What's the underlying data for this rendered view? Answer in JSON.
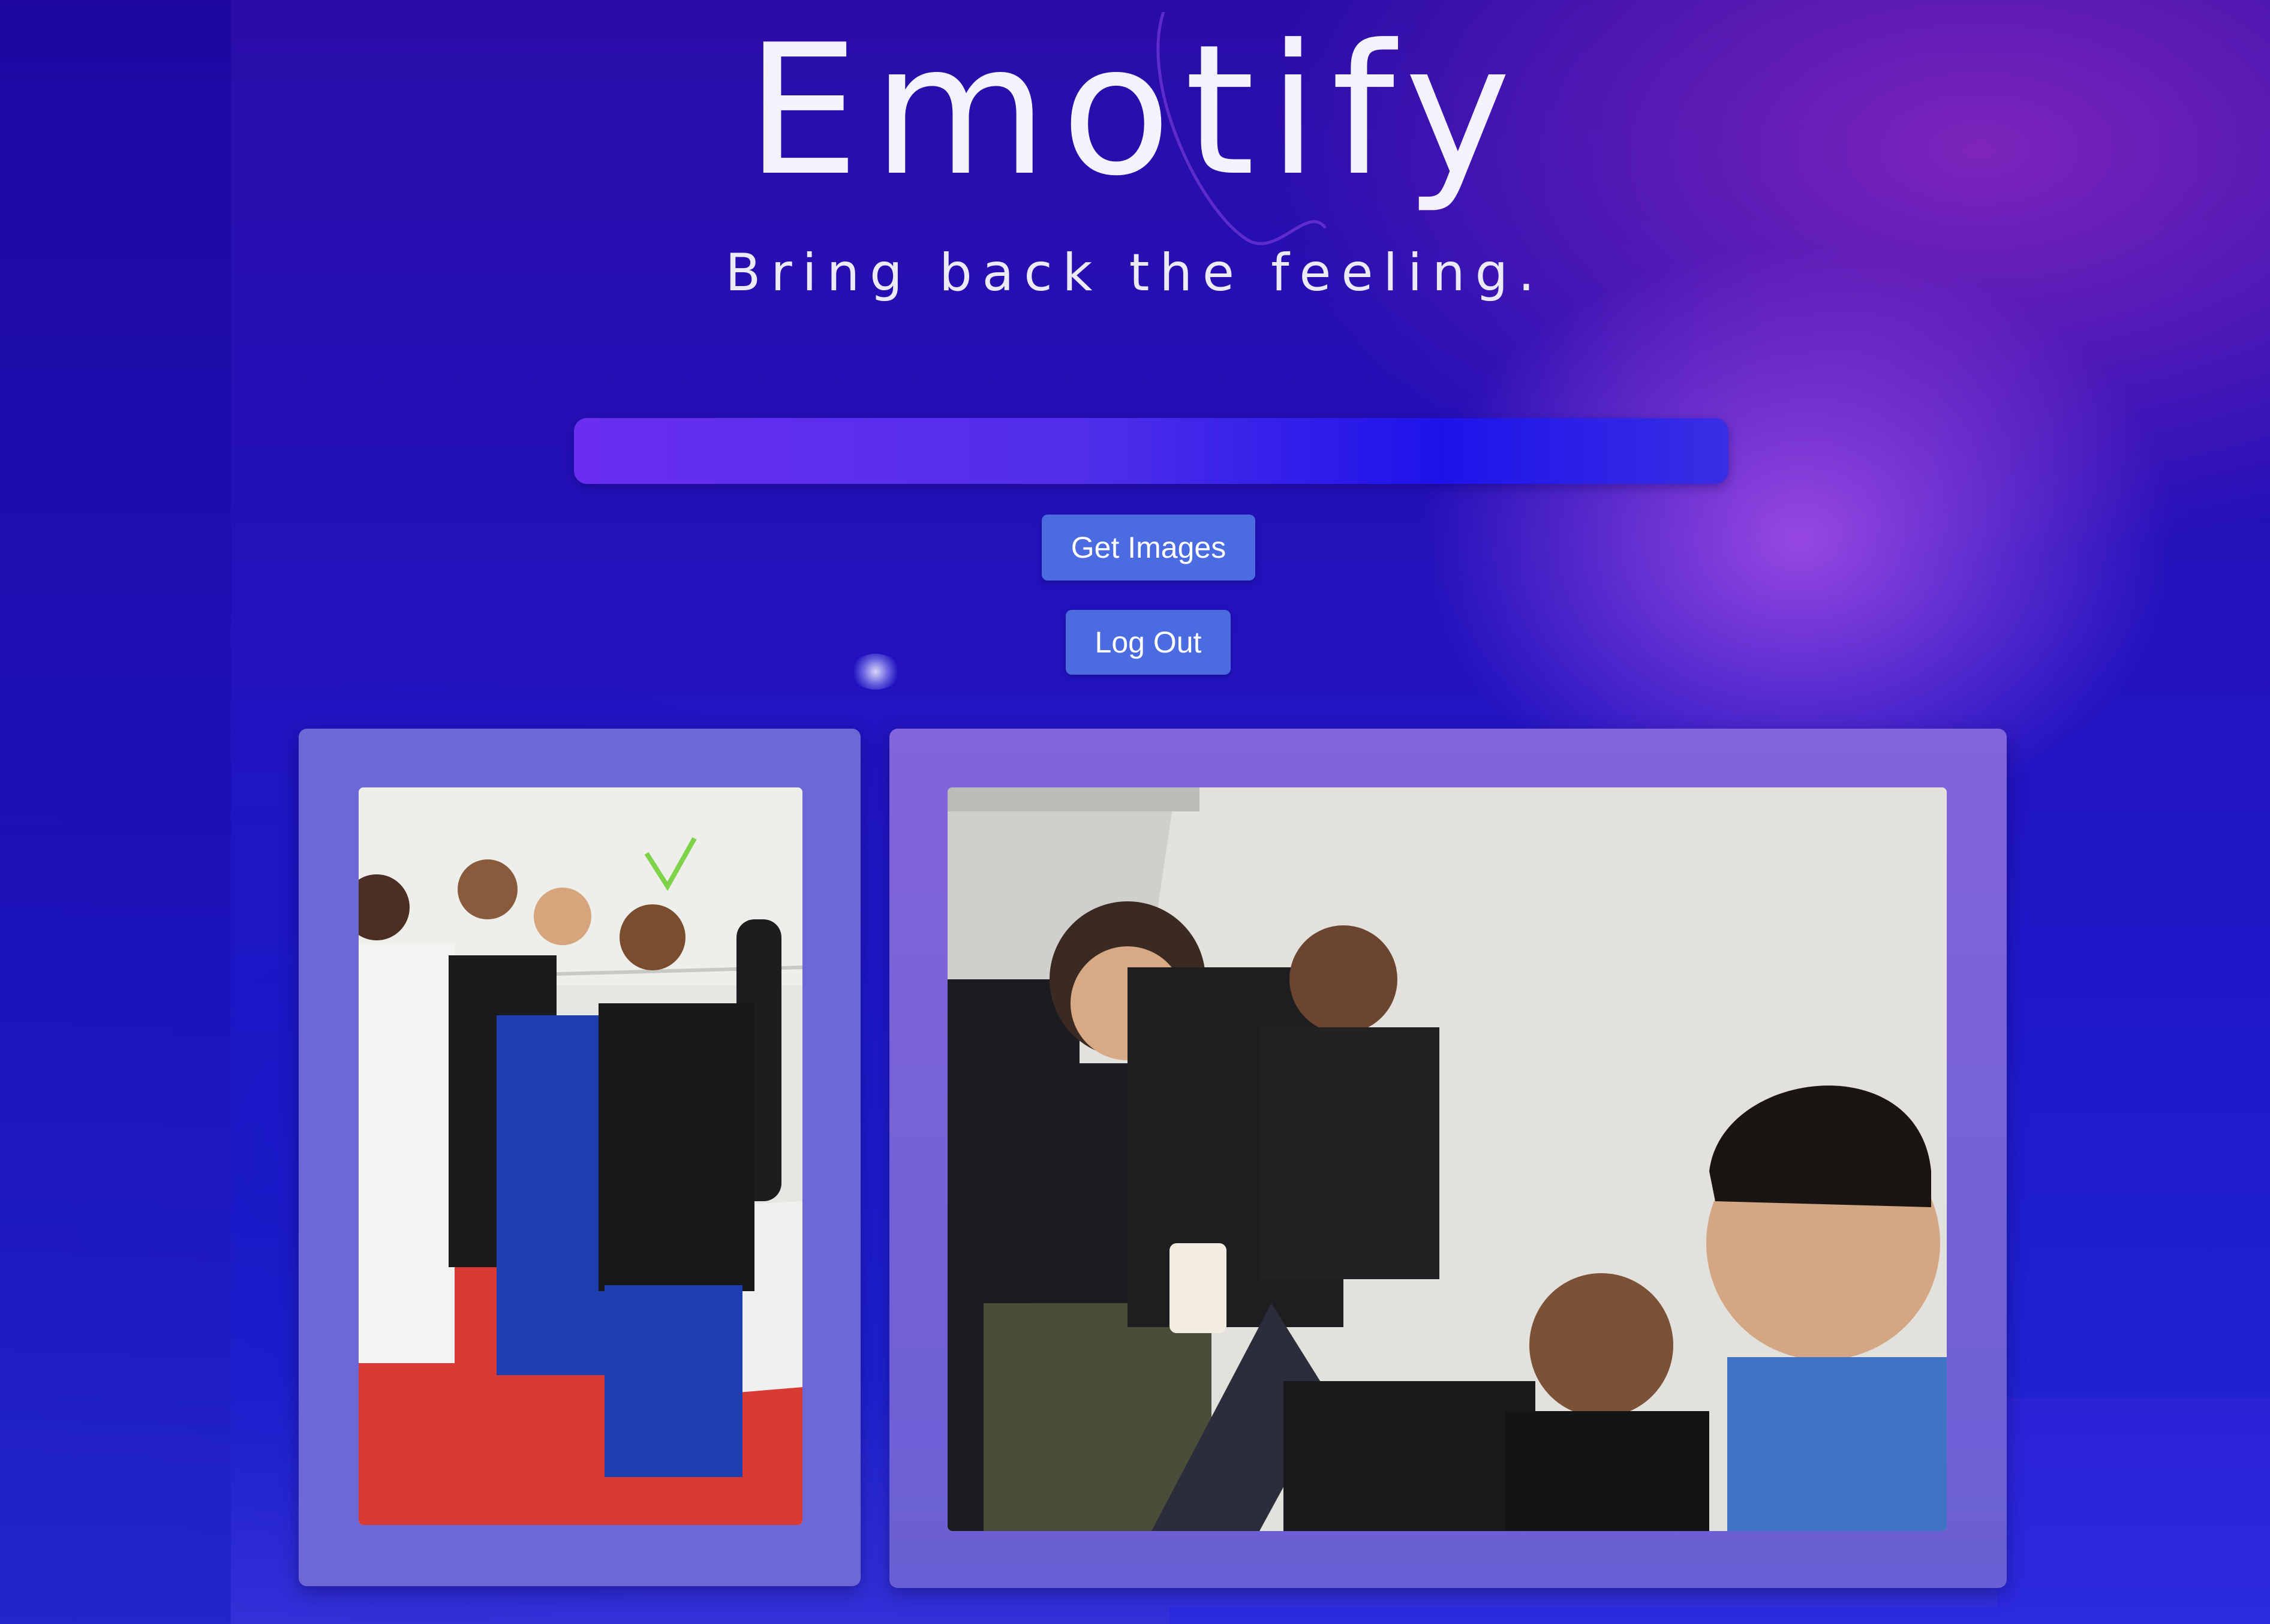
{
  "app": {
    "title": "Emotify",
    "tagline": "Bring back the feeling."
  },
  "search": {
    "value": "",
    "placeholder": ""
  },
  "buttons": {
    "get_images": "Get Images",
    "log_out": "Log Out"
  },
  "gallery": {
    "images": [
      {
        "description": "Group photo of five people in a martial arts gym on red and white mats"
      },
      {
        "description": "Selfie of four friends in a room with a white wall"
      }
    ]
  },
  "colors": {
    "button": "#4b6be0",
    "card": "#6c68d6",
    "background_top": "#2a0da8",
    "accent_purple": "#8a2be2"
  }
}
